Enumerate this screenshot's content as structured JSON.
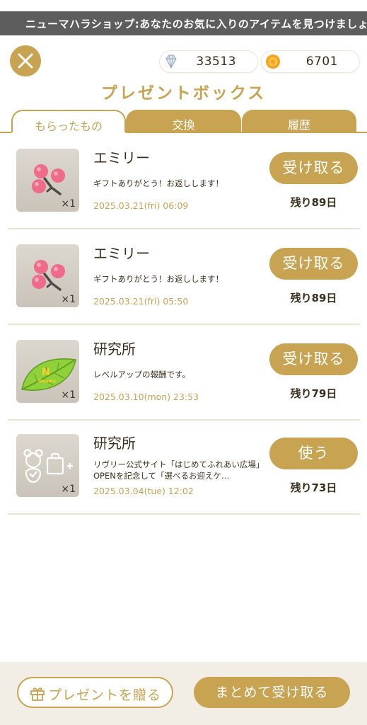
{
  "banner": {
    "text": "ニューマハラショップ:あなたのお気に入りのアイテムを見つけましょう"
  },
  "header": {
    "close_icon": "close-icon",
    "title": "プレゼントボックス",
    "currencies": {
      "gems": {
        "icon": "diamond-icon",
        "value": "33513"
      },
      "coins": {
        "icon": "coin-icon",
        "value": "6701"
      }
    }
  },
  "tabs": [
    {
      "label": "もらったもの",
      "active": true
    },
    {
      "label": "交換",
      "active": false
    },
    {
      "label": "履歴",
      "active": false
    }
  ],
  "gifts": [
    {
      "icon": "berries-icon",
      "qty": "×1",
      "sender": "エミリー",
      "message": "ギフトありがとう！お返しします！",
      "date": "2025.03.21(fri) 06:09",
      "action": "受け取る",
      "remaining": "残り89日"
    },
    {
      "icon": "berries-icon",
      "qty": "×1",
      "sender": "エミリー",
      "message": "ギフトありがとう！お返しします！",
      "date": "2025.03.21(fri) 05:50",
      "action": "受け取る",
      "remaining": "残り89日"
    },
    {
      "icon": "leaf-icon",
      "qty": "×1",
      "sender": "研究所",
      "message": "レベルアップの報酬です。",
      "date": "2025.03.10(mon) 23:53",
      "action": "受け取る",
      "remaining": "残り79日"
    },
    {
      "icon": "bear-ticket-icon",
      "qty": "×1",
      "sender": "研究所",
      "message": "リヴリー公式サイト「はじめてふれあい広場」OPENを記念して「選べるお迎えケ…",
      "date": "2025.03.04(tue) 12:02",
      "action": "使う",
      "remaining": "残り73日"
    }
  ],
  "footer": {
    "send_gift_label": "プレゼントを贈る",
    "send_gift_icon": "gift-icon",
    "bulk_claim_label": "まとめて受け取る"
  },
  "colors": {
    "accent": "#c7a352",
    "banner_bg": "#5d5d5d",
    "footer_bg": "#f2eee6",
    "text": "#3d2f1d"
  }
}
